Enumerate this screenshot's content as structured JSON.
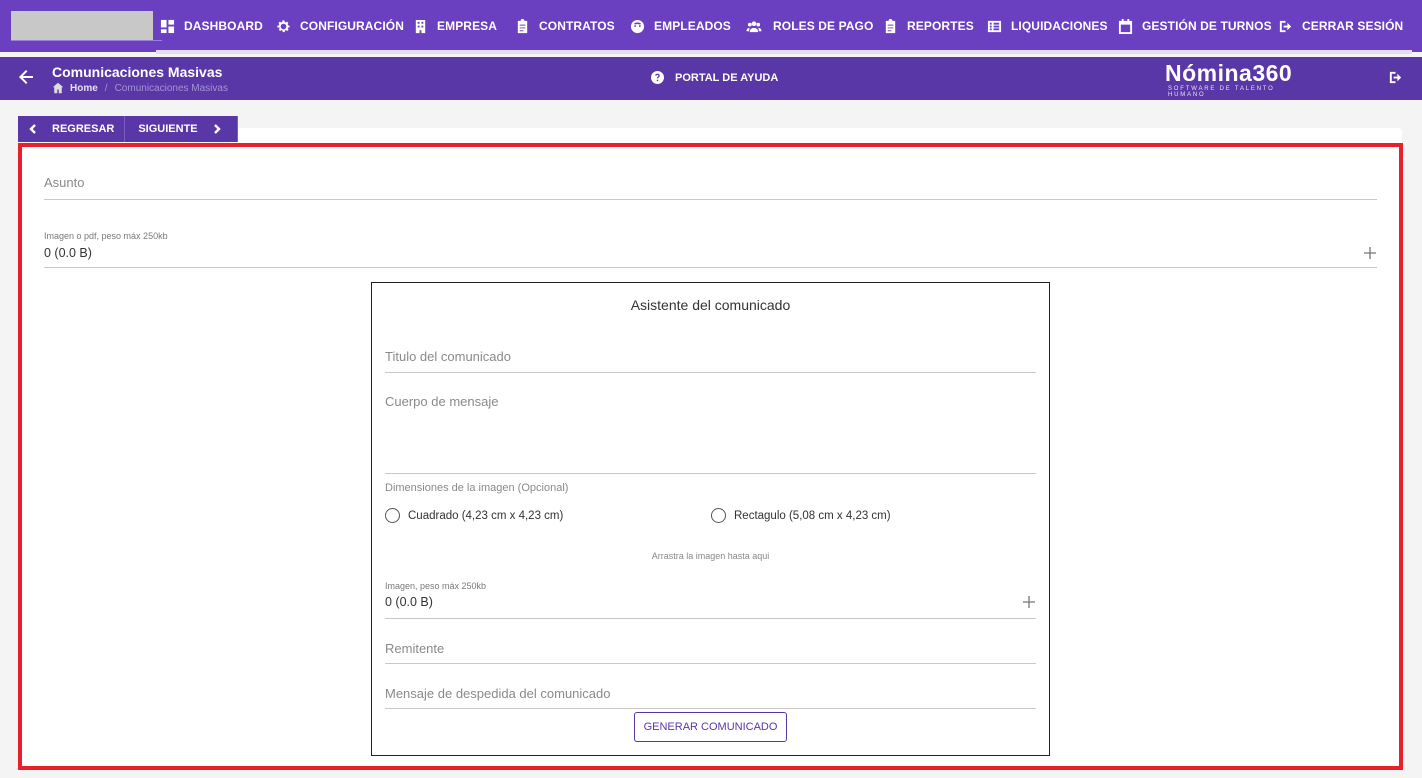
{
  "nav": {
    "items": [
      {
        "label": "DASHBOARD",
        "icon": "dashboard-icon"
      },
      {
        "label": "CONFIGURACIÓN",
        "icon": "gear-icon"
      },
      {
        "label": "EMPRESA",
        "icon": "building-icon"
      },
      {
        "label": "CONTRATOS",
        "icon": "clipboard-icon"
      },
      {
        "label": "EMPLEADOS",
        "icon": "face-icon"
      },
      {
        "label": "ROLES DE PAGO",
        "icon": "users-icon"
      },
      {
        "label": "REPORTES",
        "icon": "clipboard-icon"
      },
      {
        "label": "LIQUIDACIONES",
        "icon": "list-icon"
      },
      {
        "label": "GESTIÓN DE TURNOS",
        "icon": "calendar-icon"
      },
      {
        "label": "CERRAR SESIÓN",
        "icon": "logout-icon"
      }
    ]
  },
  "header": {
    "title": "Comunicaciones Masivas",
    "breadcrumb_home": "Home",
    "breadcrumb_sep": "/",
    "breadcrumb_current": "Comunicaciones Masivas",
    "help_label": "PORTAL DE AYUDA",
    "brand_name": "Nómina360",
    "brand_tagline": "SOFTWARE DE TALENTO HUMANO"
  },
  "stepper": {
    "back_label": "REGRESAR",
    "next_label": "SIGUIENTE"
  },
  "form": {
    "subject_placeholder": "Asunto",
    "attachment_label": "Imagen o pdf, peso máx 250kb",
    "attachment_value": "0 (0.0 B)"
  },
  "wizard": {
    "title": "Asistente del comunicado",
    "title_placeholder": "Titulo del comunicado",
    "body_placeholder": "Cuerpo de mensaje",
    "dimensions_label": "Dimensiones de la imagen (Opcional)",
    "option_square": "Cuadrado (4,23 cm x 4,23 cm)",
    "option_rect": "Rectagulo (5,08 cm x 4,23 cm)",
    "drag_hint": "Arrastra la imagen hasta aqui",
    "image_label": "Imagen, peso máx 250kb",
    "image_value": "0 (0.0 B)",
    "sender_placeholder": "Remitente",
    "farewell_placeholder": "Mensaje de despedida del comunicado",
    "generate_label": "GENERAR COMUNICADO"
  },
  "colors": {
    "primary": "#6a3fc0",
    "primary_dark": "#5a37a6",
    "highlight_border": "#e8202a"
  }
}
